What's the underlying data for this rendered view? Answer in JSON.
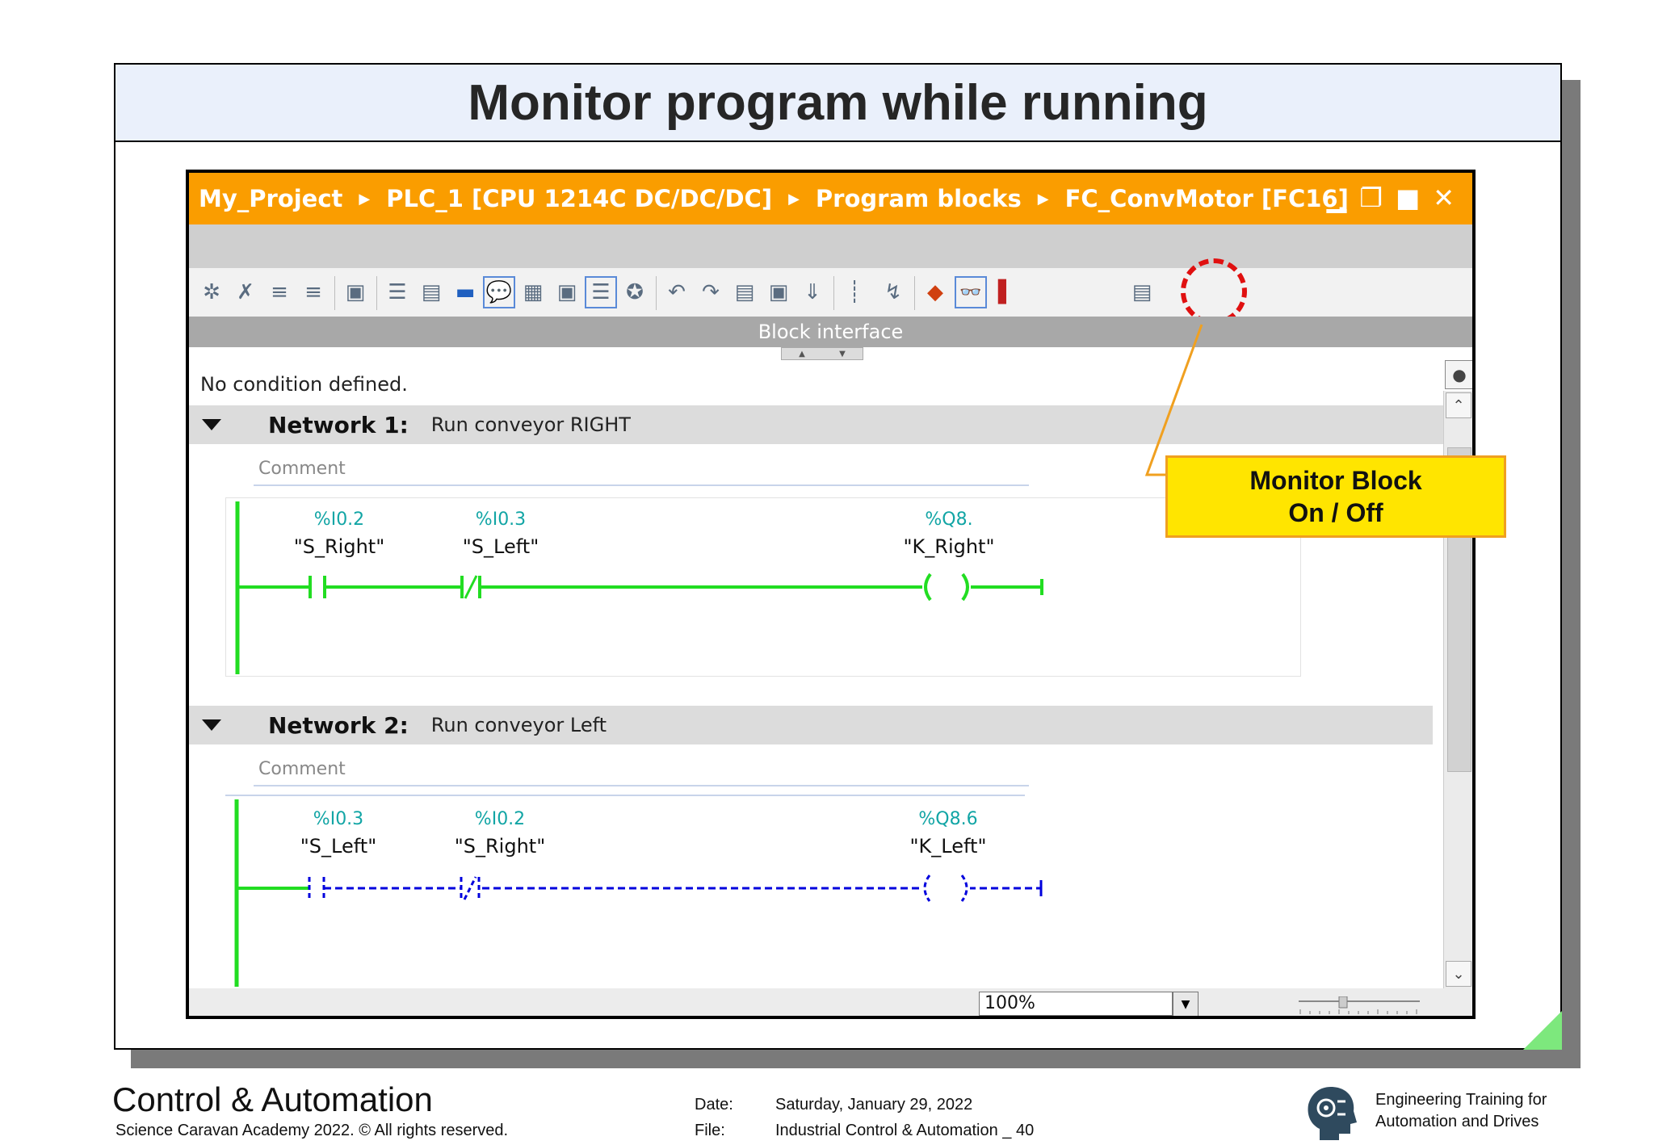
{
  "slide": {
    "title": "Monitor program while running"
  },
  "window": {
    "breadcrumb": [
      "My_Project",
      "PLC_1 [CPU 1214C DC/DC/DC]",
      "Program blocks",
      "FC_ConvMotor [FC16]"
    ],
    "controls": {
      "minimize": "▁",
      "restore": "❐",
      "maximize": "■",
      "close": "✕"
    },
    "block_interface_label": "Block interface",
    "no_condition": "No condition defined.",
    "zoom_value": "100%",
    "colors": {
      "titlebar": "#fa9d00",
      "energized": "#22dd22",
      "de_energized": "#0000dd",
      "highlight_ring": "#e01010"
    }
  },
  "networks": [
    {
      "label": "Network 1:",
      "description": "Run conveyor RIGHT",
      "comment_placeholder": "Comment",
      "contact1": {
        "address": "%I0.2",
        "tag": "\"S_Right\"",
        "type": "NO"
      },
      "contact2": {
        "address": "%I0.3",
        "tag": "\"S_Left\"",
        "type": "NC"
      },
      "coil": {
        "address": "%Q8.",
        "tag": "\"K_Right\""
      },
      "state": "energized"
    },
    {
      "label": "Network 2:",
      "description": "Run conveyor Left",
      "comment_placeholder": "Comment",
      "contact1": {
        "address": "%I0.3",
        "tag": "\"S_Left\"",
        "type": "NO"
      },
      "contact2": {
        "address": "%I0.2",
        "tag": "\"S_Right\"",
        "type": "NC"
      },
      "coil": {
        "address": "%Q8.6",
        "tag": "\"K_Left\""
      },
      "state": "de-energized"
    }
  ],
  "callout": {
    "line1": "Monitor Block",
    "line2": "On / Off"
  },
  "footer": {
    "brand": "Control & Automation",
    "copyright": "Science Caravan Academy 2022. © All rights reserved.",
    "date_label": "Date:",
    "date_value": "Saturday, January 29, 2022",
    "file_label": "File:",
    "file_value": "Industrial Control & Automation _ 40",
    "org_line1": "Engineering Training for",
    "org_line2": "Automation and Drives"
  },
  "toolbar_icons": [
    "insert-network-icon",
    "delete-network-icon",
    "insert-row-icon",
    "add-row-icon",
    "open-all-icon",
    "close-all-icon",
    "absolute-operands-icon",
    "favorites-icon",
    "comments-icon",
    "show-comments-icon",
    "expand-icon",
    "collapse-icon",
    "symbolic-icon",
    "go-to-previous-error-icon",
    "go-to-next-error-icon",
    "update-call-icon",
    "snapshot-icon",
    "compare-icon",
    "load-start-values-icon",
    "set-breakpoint-icon",
    "step-icon",
    "monitor-icon",
    "monitor-block-on-off-icon",
    "layout-icon",
    "settings-icon"
  ]
}
